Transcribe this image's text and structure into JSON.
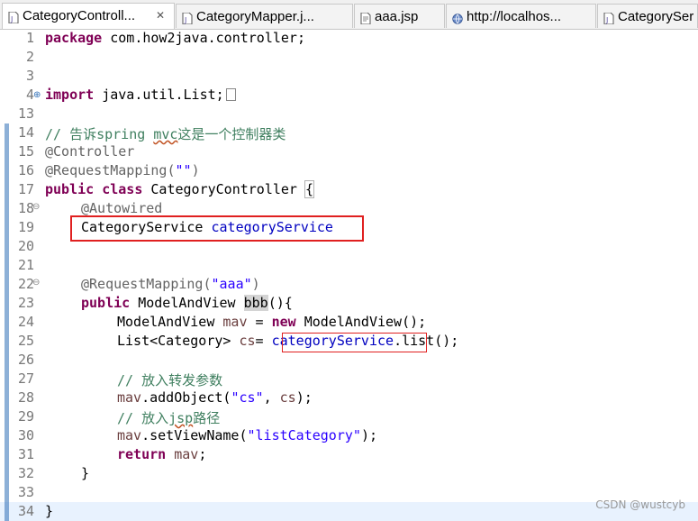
{
  "tabs": [
    {
      "label": "CategoryControll...",
      "close": "✕",
      "icon": "java-file-icon",
      "active": true
    },
    {
      "label": "CategoryMapper.j...",
      "icon": "java-file-icon"
    },
    {
      "label": "aaa.jsp",
      "icon": "jsp-file-icon"
    },
    {
      "label": "http://localhos...",
      "icon": "globe-icon"
    },
    {
      "label": "CategorySer",
      "icon": "java-file-icon"
    }
  ],
  "editor": {
    "line_numbers": [
      "1",
      "2",
      "3",
      "4",
      "13",
      "14",
      "15",
      "16",
      "17",
      "18",
      "19",
      "20",
      "21",
      "22",
      "23",
      "24",
      "25",
      "26",
      "27",
      "28",
      "29",
      "30",
      "31",
      "32",
      "33",
      "34"
    ],
    "code": {
      "l1_kw": "package",
      "l1_rest": " com.how2java.controller;",
      "l4_kw": "import",
      "l4_rest": " java.util.List;",
      "l14_comment_a": "// 告诉spring ",
      "l14_comment_b": "mvc",
      "l14_comment_c": "这是一个控制器类",
      "l15": "@Controller",
      "l16_ann": "@RequestMapping(",
      "l16_str": "\"\"",
      "l16_close": ")",
      "l17_kw": "public class",
      "l17_rest": " CategoryController ",
      "l17_brace": "{",
      "l18": "@Autowired",
      "l19_type": "CategoryService ",
      "l19_field": "categoryService",
      "l22_ann": "@RequestMapping(",
      "l22_str": "\"aaa\"",
      "l22_close": ")",
      "l23_kw": "public",
      "l23_mid": " ModelAndView ",
      "l23_name": "bbb",
      "l23_end": "(){",
      "l24_a": "ModelAndView ",
      "l24_b": "mav",
      "l24_c": " = ",
      "l24_kw": "new",
      "l24_d": " ModelAndView();",
      "l25_a": "List<Category> ",
      "l25_b": "cs",
      "l25_c": "= ",
      "l25_field": "categoryService",
      "l25_d": ".list();",
      "l27": "// 放入转发参数",
      "l28_a": "mav",
      "l28_b": ".addObject(",
      "l28_str": "\"cs\"",
      "l28_c": ", ",
      "l28_d": "cs",
      "l28_e": ");",
      "l29_a": "// 放入",
      "l29_b": "jsp",
      "l29_c": "路径",
      "l30_a": "mav",
      "l30_b": ".setViewName(",
      "l30_str": "\"listCategory\"",
      "l30_c": ");",
      "l31_kw": "return",
      "l31_rest": " mav",
      "l31_end": ";",
      "l32": "}",
      "l34": "}"
    }
  },
  "watermark": "CSDN @wustcyb"
}
